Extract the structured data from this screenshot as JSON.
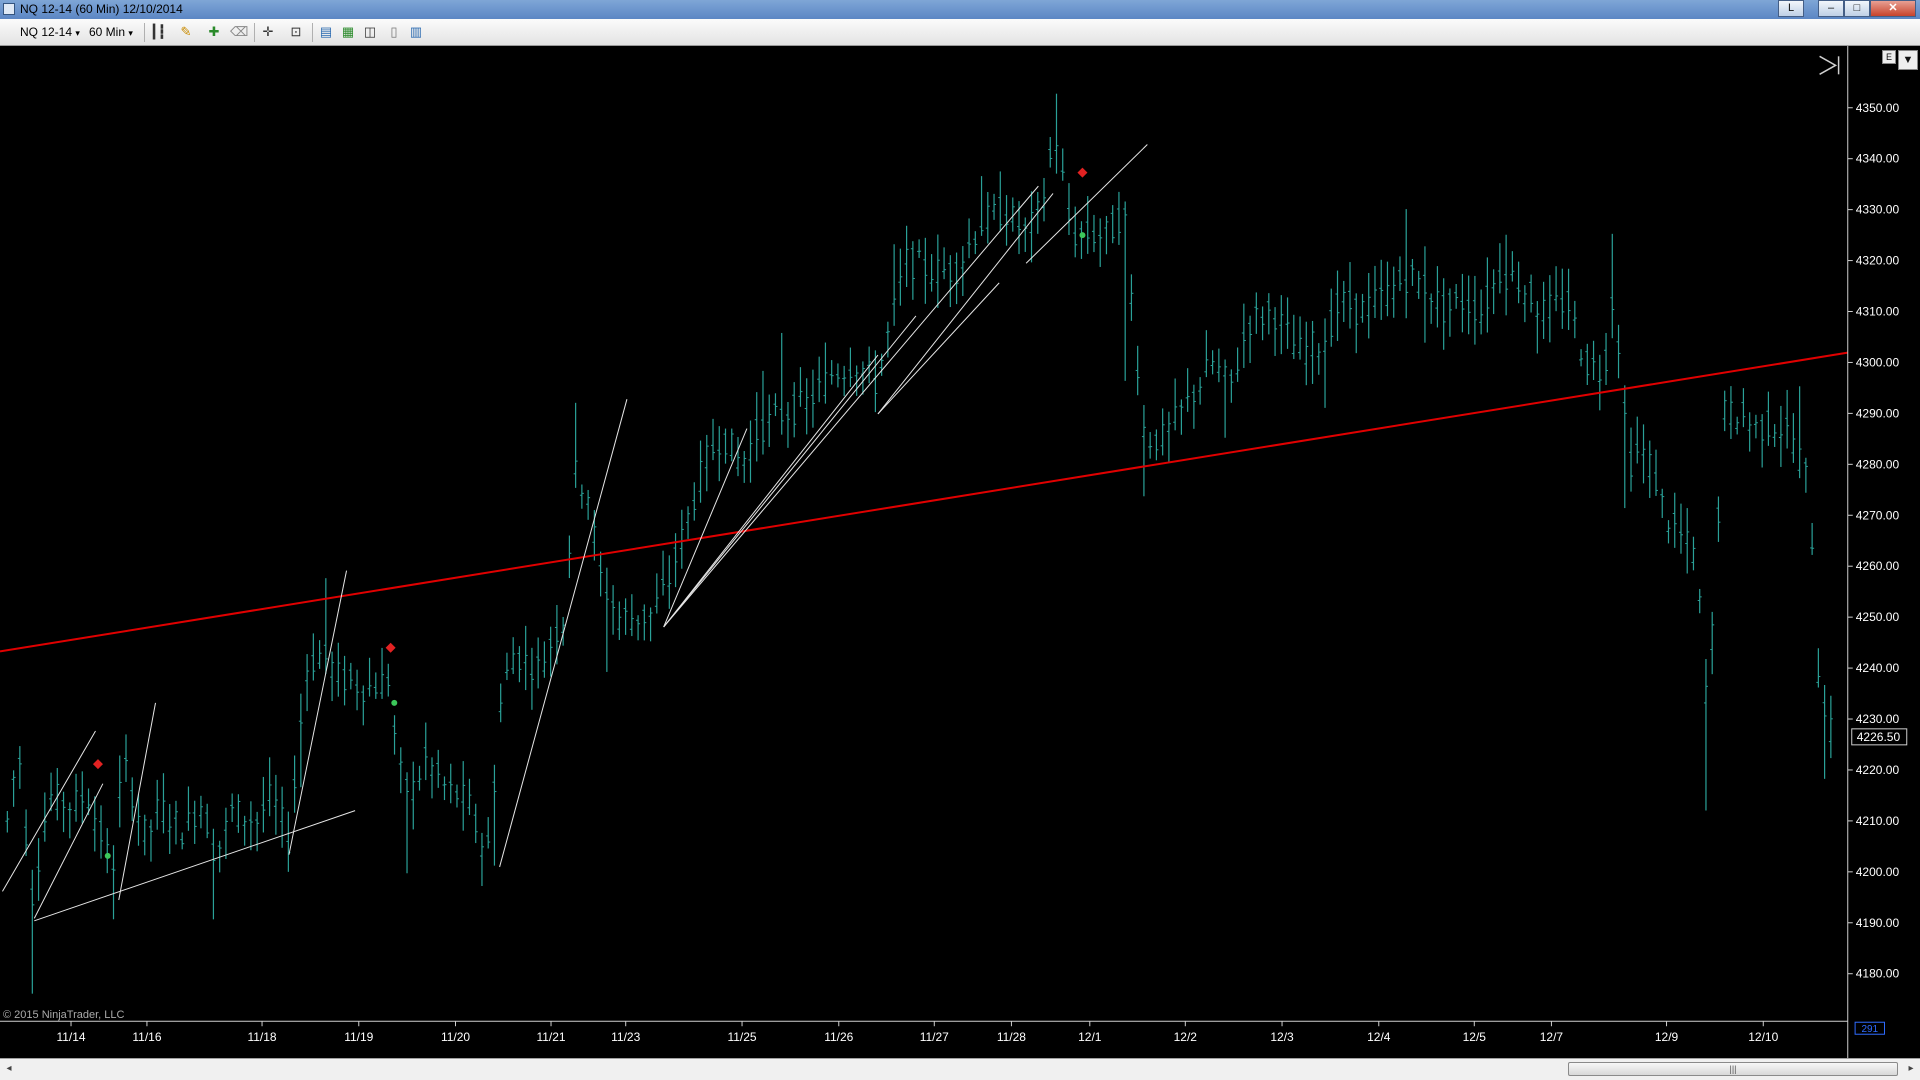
{
  "window": {
    "title": "NQ 12-14 (60 Min)  12/10/2014",
    "buttons": {
      "link": "L",
      "minimize": "–",
      "maximize": "□",
      "close": "✕"
    }
  },
  "toolbar": {
    "instrument": "NQ 12-14",
    "interval": "60 Min",
    "dropdown_arrow": "▾",
    "icons": [
      "bar-style-icon",
      "pencil-draw-icon",
      "plus-tool-icon",
      "eraser-icon",
      "crosshair-icon",
      "zoom-icon",
      "properties-icon",
      "indicators-icon",
      "strategies-icon",
      "data-box-icon",
      "layout-icon"
    ]
  },
  "chart": {
    "copyright": "© 2015 NinjaTrader, LLC",
    "last_price": "4226.50",
    "bar_count_label": "291",
    "corner_button": "E",
    "price_axis_labels": [
      "4350.00",
      "4340.00",
      "4330.00",
      "4320.00",
      "4310.00",
      "4300.00",
      "4290.00",
      "4280.00",
      "4270.00",
      "4260.00",
      "4250.00",
      "4240.00",
      "4230.00",
      "4220.00",
      "4210.00",
      "4200.00",
      "4190.00",
      "4180.00"
    ],
    "date_labels": [
      "11/14",
      "11/16",
      "11/18",
      "11/19",
      "11/20",
      "11/21",
      "11/23",
      "11/25",
      "11/26",
      "11/27",
      "11/28",
      "12/1",
      "12/2",
      "12/3",
      "12/4",
      "12/5",
      "12/7",
      "12/9",
      "12/10"
    ],
    "colors": {
      "background": "#000000",
      "bars": "#2aa198",
      "trendline": "#e00000",
      "drawing": "#e6e6e6",
      "axis_text": "#ffffff",
      "buy_marker": "#3cc85a",
      "sell_marker": "#e22222"
    }
  },
  "scrollbar": {
    "left_arrow": "◂",
    "right_arrow": "▸",
    "thumb_grip": "|||"
  }
}
